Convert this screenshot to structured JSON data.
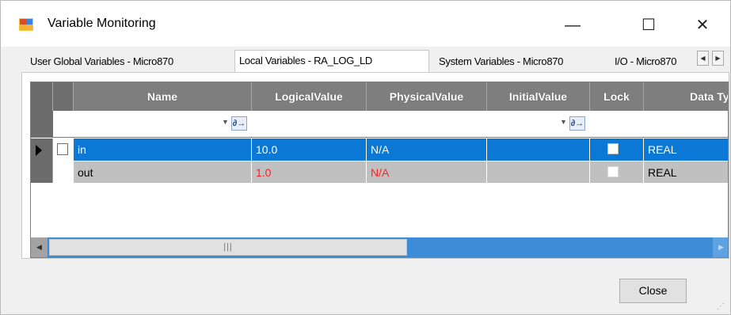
{
  "window": {
    "title": "Variable Monitoring",
    "minimize_glyph": "—",
    "maximize_glyph": "☐",
    "close_glyph": "✕",
    "icon": "variable-monitoring-icon"
  },
  "tabs": [
    {
      "label": "User Global Variables - Micro870",
      "active": false
    },
    {
      "label": "Local Variables - RA_LOG_LD",
      "active": true
    },
    {
      "label": "System Variables - Micro870",
      "active": false
    },
    {
      "label": "I/O - Micro870",
      "active": false
    }
  ],
  "tab_scroll": {
    "left": "◀",
    "right": "▶"
  },
  "grid": {
    "columns": [
      "Name",
      "LogicalValue",
      "PhysicalValue",
      "InitialValue",
      "Lock",
      "Data Type"
    ],
    "filter_icon": "filter-icon",
    "rows": [
      {
        "name": "in",
        "logical": "10.0",
        "physical": "N/A",
        "initial": "",
        "lock": false,
        "datatype": "REAL",
        "selected": true
      },
      {
        "name": "out",
        "logical": "1.0",
        "physical": "N/A",
        "initial": "",
        "lock": false,
        "datatype": "REAL",
        "selected": false
      }
    ],
    "colors": {
      "selection": "#0c78d6",
      "readonly_row": "#c0c0c0",
      "error_text": "#ff2020",
      "header": "#7e7e7e"
    }
  },
  "scrollbar": {
    "left": "◀",
    "thumb": "|||",
    "right": "▶"
  },
  "buttons": {
    "close": "Close"
  }
}
